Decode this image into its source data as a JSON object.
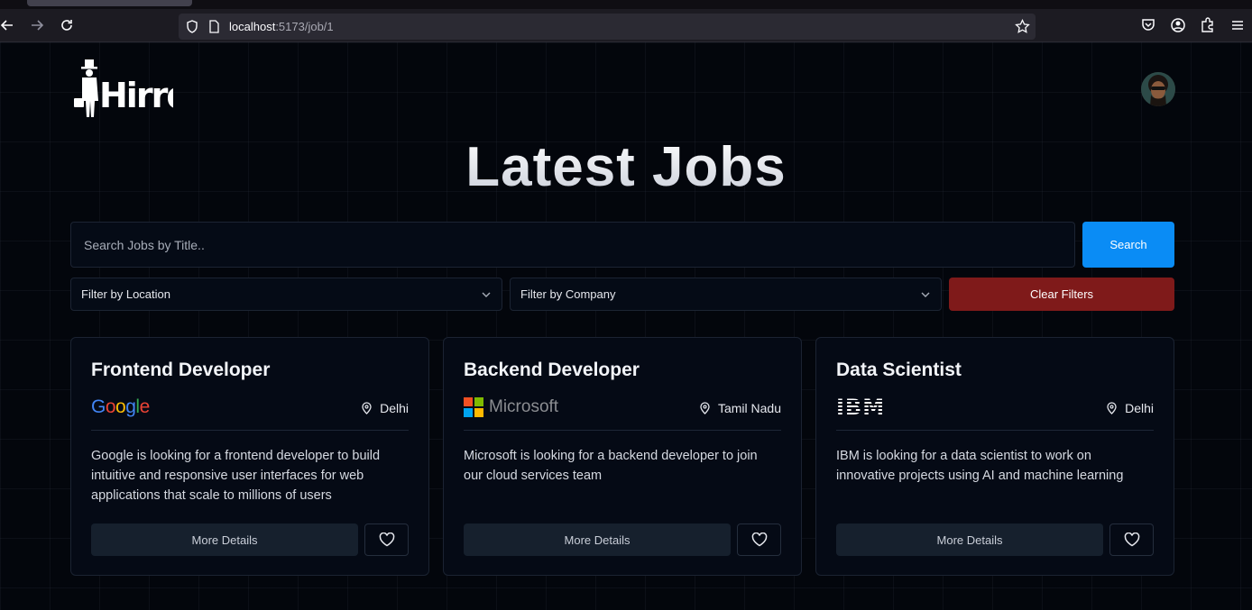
{
  "browser": {
    "url_host": "localhost",
    "url_path": ":5173/job/1"
  },
  "page": {
    "brand": "Hirrd",
    "headline": "Latest Jobs"
  },
  "search": {
    "placeholder": "Search Jobs by Title..",
    "button_label": "Search"
  },
  "filters": {
    "location_label": "Filter by Location",
    "company_label": "Filter by Company",
    "clear_label": "Clear Filters"
  },
  "jobs": [
    {
      "title": "Frontend Developer",
      "company_logo": "Google",
      "location": "Delhi",
      "description": "Google is looking for a frontend developer to build intuitive and responsive user interfaces for web applications that scale to millions of users",
      "details_label": "More Details"
    },
    {
      "title": "Backend Developer",
      "company_logo": "Microsoft",
      "location": "Tamil Nadu",
      "description": "Microsoft is looking for a backend developer to join our cloud services team",
      "details_label": "More Details"
    },
    {
      "title": "Data Scientist",
      "company_logo": "IBM",
      "location": "Delhi",
      "description": "IBM is looking for a data scientist to work on innovative projects using AI and machine learning",
      "details_label": "More Details"
    }
  ],
  "colors": {
    "accent": "#0a8cf5",
    "danger": "#7f1a1a",
    "background": "#03060c"
  },
  "icons": [
    "back-arrow-icon",
    "forward-arrow-icon",
    "reload-icon",
    "shield-icon",
    "page-icon",
    "star-icon",
    "pocket-icon",
    "account-icon",
    "extensions-icon",
    "menu-icon",
    "chevron-down-icon",
    "map-pin-icon",
    "heart-icon"
  ]
}
